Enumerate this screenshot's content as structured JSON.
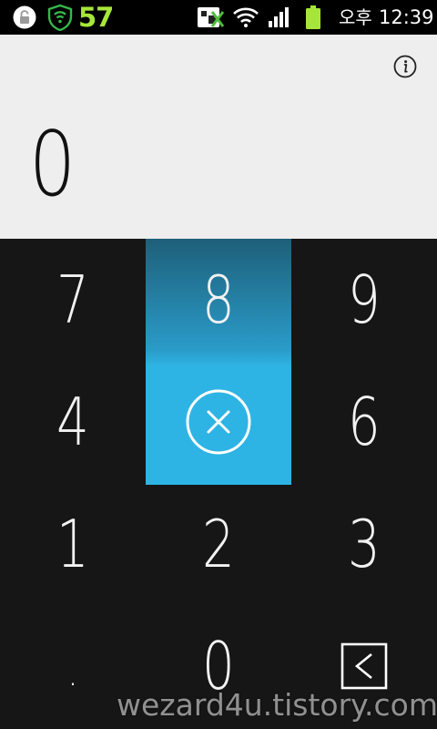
{
  "status_bar": {
    "notification_count": "57",
    "ampm": "오후",
    "time": "12:39",
    "icons": [
      "lock-icon",
      "shield-icon",
      "notification-icon",
      "wifi-icon",
      "signal-icon",
      "battery-icon"
    ],
    "accent_color": "#a6e63a"
  },
  "display": {
    "value": "0",
    "info_icon": "info-icon",
    "background": "#eeeeee"
  },
  "keypad": {
    "highlight_color": "#2db3e4",
    "keys": {
      "seven": "7",
      "eight": "8",
      "nine": "9",
      "four": "4",
      "six": "6",
      "one": "1",
      "two": "2",
      "three": "3",
      "dot": ".",
      "zero": "0"
    },
    "clear_icon": "clear-circle-x-icon",
    "backspace_icon": "backspace-icon"
  },
  "watermark": "wezard4u.tistory.com"
}
